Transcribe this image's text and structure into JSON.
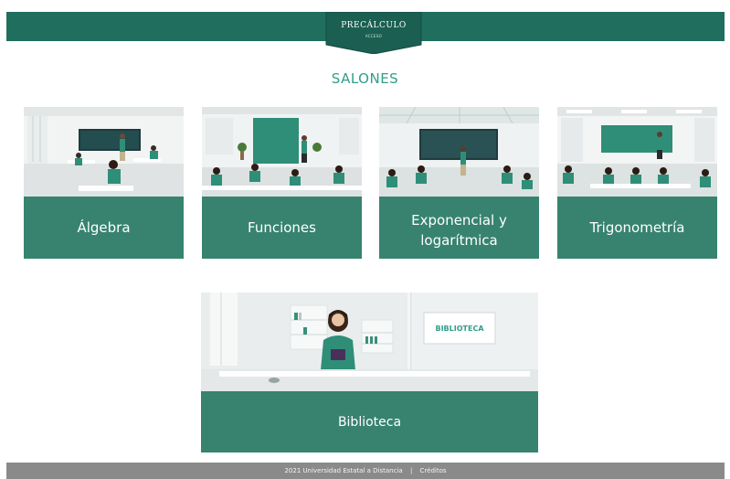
{
  "header": {
    "logo_title": "PRECÁLCULO",
    "logo_sub": "ACCESO"
  },
  "section_title": "SALONES",
  "cards": [
    {
      "label_line1": "Álgebra",
      "label_line2": ""
    },
    {
      "label_line1": "Funciones",
      "label_line2": ""
    },
    {
      "label_line1": "Exponencial y",
      "label_line2": "logarítmica"
    },
    {
      "label_line1": "Trigonometría",
      "label_line2": ""
    }
  ],
  "library": {
    "label": "Biblioteca",
    "sign": "BIBLIOTECA"
  },
  "footer": {
    "copyright": "2021 Universidad Estatal a Distancia",
    "separator": "|",
    "credits": "Créditos"
  },
  "colors": {
    "brand_green": "#1f6e5e",
    "card_green": "#37836f",
    "title_teal": "#2f9e8a",
    "footer_gray": "#8a8a8a"
  }
}
